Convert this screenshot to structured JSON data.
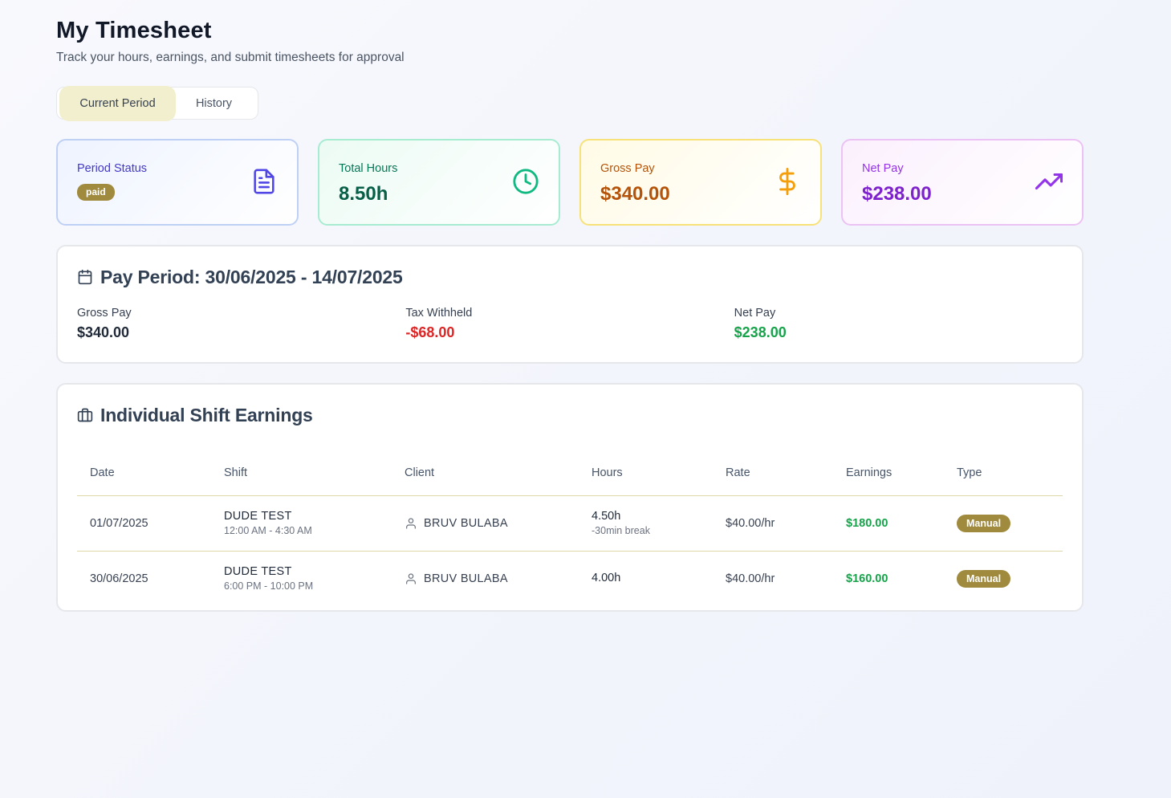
{
  "header": {
    "title": "My Timesheet",
    "subtitle": "Track your hours, earnings, and submit timesheets for approval"
  },
  "tabs": [
    {
      "label": "Current Period",
      "active": true
    },
    {
      "label": "History",
      "active": false
    }
  ],
  "cards": {
    "status": {
      "label": "Period Status",
      "badge": "paid",
      "icon": "document-icon"
    },
    "hours": {
      "label": "Total Hours",
      "value": "8.50h",
      "icon": "clock-icon"
    },
    "gross": {
      "label": "Gross Pay",
      "value": "$340.00",
      "icon": "dollar-icon"
    },
    "net": {
      "label": "Net Pay",
      "value": "$238.00",
      "icon": "trending-up-icon"
    }
  },
  "pay_period": {
    "title": "Pay Period: 30/06/2025 - 14/07/2025",
    "icon": "calendar-icon",
    "gross_label": "Gross Pay",
    "gross_value": "$340.00",
    "tax_label": "Tax Withheld",
    "tax_value": "-$68.00",
    "net_label": "Net Pay",
    "net_value": "$238.00"
  },
  "shifts": {
    "title": "Individual Shift Earnings",
    "icon": "briefcase-icon",
    "columns": [
      "Date",
      "Shift",
      "Client",
      "Hours",
      "Rate",
      "Earnings",
      "Type"
    ],
    "rows": [
      {
        "date": "01/07/2025",
        "shift": "DUDE TEST",
        "time": "12:00 AM - 4:30 AM",
        "client": "BRUV BULABA",
        "hours": "4.50h",
        "break": "-30min break",
        "rate": "$40.00/hr",
        "earnings": "$180.00",
        "type": "Manual"
      },
      {
        "date": "30/06/2025",
        "shift": "DUDE TEST",
        "time": "6:00 PM - 10:00 PM",
        "client": "BRUV BULABA",
        "hours": "4.00h",
        "break": "",
        "rate": "$40.00/hr",
        "earnings": "$160.00",
        "type": "Manual"
      }
    ]
  },
  "colors": {
    "accent_badge": "#a08a3e",
    "tab_active_bg": "#f2efcf",
    "positive": "#16a34a",
    "negative": "#dc2626"
  }
}
